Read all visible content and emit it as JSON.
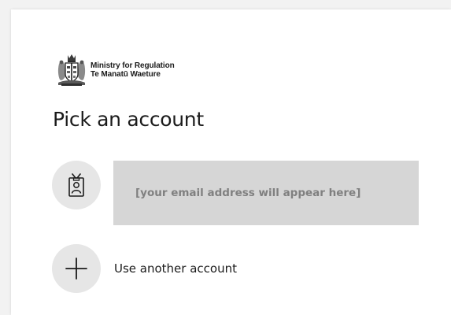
{
  "org": {
    "name_line1": "Ministry for Regulation",
    "name_line2": "Te Manatū Waeture",
    "logo_icon": "nz-coat-of-arms-icon"
  },
  "page": {
    "title": "Pick an account"
  },
  "accounts": [
    {
      "email": "[your email address will appear here]",
      "icon": "id-badge-icon"
    }
  ],
  "use_another": {
    "label": "Use another account",
    "icon": "plus-icon"
  },
  "colors": {
    "background": "#f2f2f2",
    "card": "#ffffff",
    "avatar_circle": "#e6e6e6",
    "email_highlight": "#d6d6d6",
    "email_text": "#808080",
    "text": "#1b1b1b"
  }
}
